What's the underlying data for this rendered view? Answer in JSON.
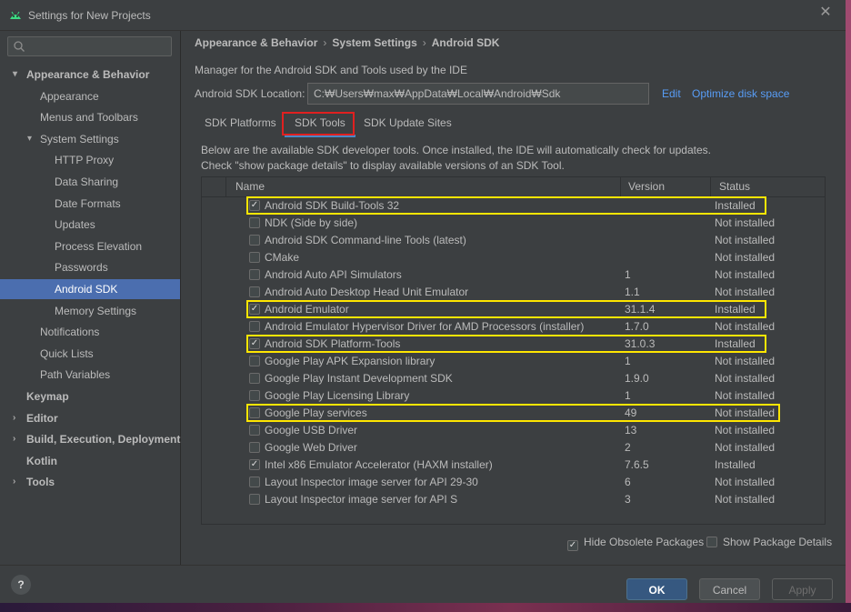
{
  "window": {
    "title": "Settings for New Projects"
  },
  "sidebar": {
    "search_placeholder": "",
    "items": [
      {
        "label": "Appearance & Behavior",
        "bold": true,
        "arrow": "▾"
      },
      {
        "label": "Appearance"
      },
      {
        "label": "Menus and Toolbars"
      },
      {
        "label": "System Settings",
        "arrow": "▾"
      },
      {
        "label": "HTTP Proxy"
      },
      {
        "label": "Data Sharing"
      },
      {
        "label": "Date Formats"
      },
      {
        "label": "Updates"
      },
      {
        "label": "Process Elevation"
      },
      {
        "label": "Passwords"
      },
      {
        "label": "Android SDK",
        "selected": true
      },
      {
        "label": "Memory Settings"
      },
      {
        "label": "Notifications"
      },
      {
        "label": "Quick Lists"
      },
      {
        "label": "Path Variables"
      },
      {
        "label": "Keymap",
        "bold": true
      },
      {
        "label": "Editor",
        "bold": true,
        "arrow": "›"
      },
      {
        "label": "Build, Execution, Deployment",
        "bold": true,
        "arrow": "›"
      },
      {
        "label": "Kotlin",
        "bold": true
      },
      {
        "label": "Tools",
        "bold": true,
        "arrow": "›"
      }
    ]
  },
  "breadcrumb": [
    "Appearance & Behavior",
    "System Settings",
    "Android SDK"
  ],
  "description": "Manager for the Android SDK and Tools used by the IDE",
  "sdk_location": {
    "label": "Android SDK Location:",
    "value": "C:₩Users₩max₩AppData₩Local₩Android₩Sdk",
    "edit": "Edit",
    "optimize": "Optimize disk space"
  },
  "tabs": [
    "SDK Platforms",
    "SDK Tools",
    "SDK Update Sites"
  ],
  "active_tab": "SDK Tools",
  "info": [
    "Below are the available SDK developer tools. Once installed, the IDE will automatically check for updates.",
    "Check \"show package details\" to display available versions of an SDK Tool."
  ],
  "table": {
    "headers": [
      "Name",
      "Version",
      "Status"
    ],
    "rows": [
      {
        "name": "Android SDK Build-Tools 32",
        "version": "",
        "status": "Installed",
        "checked": true,
        "highlight": true
      },
      {
        "name": "NDK (Side by side)",
        "version": "",
        "status": "Not installed",
        "checked": false
      },
      {
        "name": "Android SDK Command-line Tools (latest)",
        "version": "",
        "status": "Not installed",
        "checked": false
      },
      {
        "name": "CMake",
        "version": "",
        "status": "Not installed",
        "checked": false
      },
      {
        "name": "Android Auto API Simulators",
        "version": "1",
        "status": "Not installed",
        "checked": false
      },
      {
        "name": "Android Auto Desktop Head Unit Emulator",
        "version": "1.1",
        "status": "Not installed",
        "checked": false
      },
      {
        "name": "Android Emulator",
        "version": "31.1.4",
        "status": "Installed",
        "checked": true,
        "highlight": true
      },
      {
        "name": "Android Emulator Hypervisor Driver for AMD Processors (installer)",
        "version": "1.7.0",
        "status": "Not installed",
        "checked": false
      },
      {
        "name": "Android SDK Platform-Tools",
        "version": "31.0.3",
        "status": "Installed",
        "checked": true,
        "highlight": true
      },
      {
        "name": "Google Play APK Expansion library",
        "version": "1",
        "status": "Not installed",
        "checked": false
      },
      {
        "name": "Google Play Instant Development SDK",
        "version": "1.9.0",
        "status": "Not installed",
        "checked": false
      },
      {
        "name": "Google Play Licensing Library",
        "version": "1",
        "status": "Not installed",
        "checked": false
      },
      {
        "name": "Google Play services",
        "version": "49",
        "status": "Not installed",
        "checked": false,
        "highlight": true
      },
      {
        "name": "Google USB Driver",
        "version": "13",
        "status": "Not installed",
        "checked": false
      },
      {
        "name": "Google Web Driver",
        "version": "2",
        "status": "Not installed",
        "checked": false
      },
      {
        "name": "Intel x86 Emulator Accelerator (HAXM installer)",
        "version": "7.6.5",
        "status": "Installed",
        "checked": true
      },
      {
        "name": "Layout Inspector image server for API 29-30",
        "version": "6",
        "status": "Not installed",
        "checked": false
      },
      {
        "name": "Layout Inspector image server for API S",
        "version": "3",
        "status": "Not installed",
        "checked": false
      }
    ]
  },
  "options": {
    "hide_obsolete": {
      "label": "Hide Obsolete Packages",
      "checked": true
    },
    "show_details": {
      "label": "Show Package Details",
      "checked": false
    }
  },
  "buttons": {
    "help": "?",
    "ok": "OK",
    "cancel": "Cancel",
    "apply": "Apply"
  },
  "colors": {
    "accent": "#4b6eaf",
    "highlight_box": "#ffe600",
    "active_tab_box": "#e02020",
    "link": "#589df6"
  }
}
